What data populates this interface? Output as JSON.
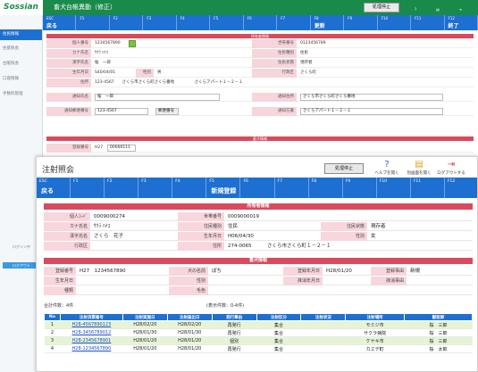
{
  "background": {
    "logo": "Sossian",
    "title": "畜犬台帳異動（修正）",
    "stop_button": "処理停止",
    "header_icons": [
      "",
      "",
      ""
    ],
    "fkeys": [
      {
        "num": "ESC",
        "label": "戻る"
      },
      {
        "num": "F1",
        "label": ""
      },
      {
        "num": "F2",
        "label": ""
      },
      {
        "num": "F3",
        "label": ""
      },
      {
        "num": "F4",
        "label": ""
      },
      {
        "num": "F5",
        "label": ""
      },
      {
        "num": "F6",
        "label": ""
      },
      {
        "num": "F7",
        "label": ""
      },
      {
        "num": "F8",
        "label": "更新"
      },
      {
        "num": "F9",
        "label": ""
      },
      {
        "num": "F10",
        "label": ""
      },
      {
        "num": "F11",
        "label": ""
      },
      {
        "num": "F12",
        "label": "終了"
      }
    ],
    "sidebar": [
      "住民情報",
      "住基照会",
      "台帳照会",
      "口座情報",
      "手数料管理"
    ],
    "sidebar_user": "ログイン中",
    "sidebar_login": "ログアウト",
    "section1": "所有者情報",
    "section2": "畜犬情報",
    "rows": [
      {
        "l1": "個人番号",
        "v1": "1234567890",
        "l2": "世帯番号",
        "v2": "0123456789"
      },
      {
        "l1": "カナ氏名",
        "v1": "ｻｸﾗ ﾊﾅｺ",
        "l2": "住民種別",
        "v2": "住民"
      },
      {
        "l1": "漢字氏名",
        "v1": "桜　一郎",
        "l2": "住民状態",
        "v2": "現存者"
      },
      {
        "l1": "生年月日",
        "v1": "S40/04/01",
        "l2": "性別",
        "v2": "男",
        "l3": "行政区",
        "v3": "さくら町"
      },
      {
        "l1": "住所",
        "v1": "123-4567　　さくら市さくら町さくら番地　　　　　さくらアパート１－２－１"
      },
      {
        "l1": "通知氏名",
        "v1": "桜　一郎",
        "l2": "通知住所",
        "v2": "さくら市さくら町さくら番地"
      },
      {
        "l1": "通知郵便番号",
        "v1": "123-4567",
        "l2": "通知方書",
        "v2": "さくらアパート１－２－１"
      }
    ],
    "reg_label": "登録番号",
    "reg_prefix": "H27",
    "reg_value": "00000111",
    "search_btn": "郵便番号"
  },
  "modal": {
    "title": "注射照会",
    "stop_button": "処理停止",
    "icons": [
      {
        "glyph": "?",
        "label": "ヘルプを開く"
      },
      {
        "glyph": "▤",
        "label": "別画面を開く"
      },
      {
        "glyph": "⇥",
        "label": "ログアウトする"
      }
    ],
    "fkeys": [
      {
        "num": "ESC",
        "label": "戻る"
      },
      {
        "num": "F1",
        "label": ""
      },
      {
        "num": "F2",
        "label": ""
      },
      {
        "num": "F3",
        "label": ""
      },
      {
        "num": "F4",
        "label": ""
      },
      {
        "num": "F5",
        "label": "新規登録"
      },
      {
        "num": "F6",
        "label": ""
      },
      {
        "num": "F7",
        "label": ""
      },
      {
        "num": "F8",
        "label": ""
      },
      {
        "num": "F9",
        "label": ""
      },
      {
        "num": "F10",
        "label": ""
      },
      {
        "num": "F11",
        "label": ""
      },
      {
        "num": "F12",
        "label": ""
      }
    ],
    "owner_header": "所有者情報",
    "owner": {
      "kojin_label": "個人ｺｰﾄﾞ",
      "kojin": "0009000274",
      "setai_label": "世帯番号",
      "setai": "0009000019",
      "kana_label": "カナ氏名",
      "kana": "ｻｸﾗ ﾊﾅｺ",
      "shubetsu_label": "住民種別",
      "shubetsu": "住民",
      "jotai_label": "住民状態",
      "jotai": "現存者",
      "kanji_label": "漢字氏名",
      "kanji": "さくら　花子",
      "birth_label": "生年月日",
      "birth": "H06/04/30",
      "sex_label": "性別",
      "sex": "女",
      "ward_label": "行政区",
      "ward": "",
      "addr_label": "住所",
      "addr_zip": "274-0065",
      "addr": "さくら市さくら町１－２－１"
    },
    "dog_header": "畜犬情報",
    "dog": {
      "reg_label": "登録番号",
      "reg": "H27　1234567890",
      "name_label": "犬の名前",
      "name": "ぽち",
      "regdate_label": "登録年月日",
      "regdate": "H28/01/20",
      "reason_label": "登録事由",
      "reason": "新規",
      "birth_label": "生年月日",
      "birth": "",
      "sex_label": "性別",
      "sex": "",
      "deldate_label": "抹消年月日",
      "deldate": "",
      "delreason_label": "抹消事由",
      "delreason": "",
      "breed_label": "種類",
      "breed": "",
      "color_label": "毛色",
      "color": ""
    },
    "count_text": "合計件数：4件",
    "display_text": "(表示件数：0-4件)",
    "table_headers": [
      "No",
      "注射済票番号",
      "注射実施日",
      "注射届出日",
      "発行事由",
      "注射区分",
      "注射状況",
      "注射場所",
      "獣医師"
    ],
    "rows": [
      [
        "1",
        "H28-4567890123",
        "H28/02/20",
        "H28/02/20",
        "再発行",
        "集合",
        "",
        "モミジ市",
        "桜　三郎"
      ],
      [
        "2",
        "H28-3456789012",
        "H28/01/30",
        "H28/01/30",
        "再発行",
        "集合",
        "",
        "サクラ病院",
        "桜　三郎"
      ],
      [
        "3",
        "H28-2345678901",
        "H28/01/20",
        "H28/01/20",
        "個別",
        "集合",
        "",
        "ケヤキ市",
        "桜　三郎"
      ],
      [
        "4",
        "H28-1234567890",
        "H28/01/20",
        "H28/01/20",
        "再発行",
        "集合",
        "",
        "カエデ町",
        "桜　太郎"
      ]
    ]
  }
}
